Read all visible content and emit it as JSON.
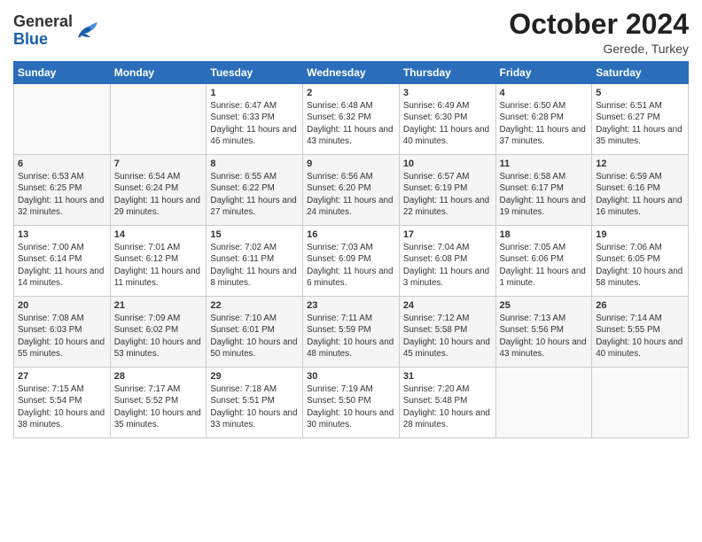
{
  "header": {
    "logo_general": "General",
    "logo_blue": "Blue",
    "title": "October 2024",
    "location": "Gerede, Turkey"
  },
  "weekdays": [
    "Sunday",
    "Monday",
    "Tuesday",
    "Wednesday",
    "Thursday",
    "Friday",
    "Saturday"
  ],
  "weeks": [
    [
      {
        "day": "",
        "info": ""
      },
      {
        "day": "",
        "info": ""
      },
      {
        "day": "1",
        "info": "Sunrise: 6:47 AM\nSunset: 6:33 PM\nDaylight: 11 hours and 46 minutes."
      },
      {
        "day": "2",
        "info": "Sunrise: 6:48 AM\nSunset: 6:32 PM\nDaylight: 11 hours and 43 minutes."
      },
      {
        "day": "3",
        "info": "Sunrise: 6:49 AM\nSunset: 6:30 PM\nDaylight: 11 hours and 40 minutes."
      },
      {
        "day": "4",
        "info": "Sunrise: 6:50 AM\nSunset: 6:28 PM\nDaylight: 11 hours and 37 minutes."
      },
      {
        "day": "5",
        "info": "Sunrise: 6:51 AM\nSunset: 6:27 PM\nDaylight: 11 hours and 35 minutes."
      }
    ],
    [
      {
        "day": "6",
        "info": "Sunrise: 6:53 AM\nSunset: 6:25 PM\nDaylight: 11 hours and 32 minutes."
      },
      {
        "day": "7",
        "info": "Sunrise: 6:54 AM\nSunset: 6:24 PM\nDaylight: 11 hours and 29 minutes."
      },
      {
        "day": "8",
        "info": "Sunrise: 6:55 AM\nSunset: 6:22 PM\nDaylight: 11 hours and 27 minutes."
      },
      {
        "day": "9",
        "info": "Sunrise: 6:56 AM\nSunset: 6:20 PM\nDaylight: 11 hours and 24 minutes."
      },
      {
        "day": "10",
        "info": "Sunrise: 6:57 AM\nSunset: 6:19 PM\nDaylight: 11 hours and 22 minutes."
      },
      {
        "day": "11",
        "info": "Sunrise: 6:58 AM\nSunset: 6:17 PM\nDaylight: 11 hours and 19 minutes."
      },
      {
        "day": "12",
        "info": "Sunrise: 6:59 AM\nSunset: 6:16 PM\nDaylight: 11 hours and 16 minutes."
      }
    ],
    [
      {
        "day": "13",
        "info": "Sunrise: 7:00 AM\nSunset: 6:14 PM\nDaylight: 11 hours and 14 minutes."
      },
      {
        "day": "14",
        "info": "Sunrise: 7:01 AM\nSunset: 6:12 PM\nDaylight: 11 hours and 11 minutes."
      },
      {
        "day": "15",
        "info": "Sunrise: 7:02 AM\nSunset: 6:11 PM\nDaylight: 11 hours and 8 minutes."
      },
      {
        "day": "16",
        "info": "Sunrise: 7:03 AM\nSunset: 6:09 PM\nDaylight: 11 hours and 6 minutes."
      },
      {
        "day": "17",
        "info": "Sunrise: 7:04 AM\nSunset: 6:08 PM\nDaylight: 11 hours and 3 minutes."
      },
      {
        "day": "18",
        "info": "Sunrise: 7:05 AM\nSunset: 6:06 PM\nDaylight: 11 hours and 1 minute."
      },
      {
        "day": "19",
        "info": "Sunrise: 7:06 AM\nSunset: 6:05 PM\nDaylight: 10 hours and 58 minutes."
      }
    ],
    [
      {
        "day": "20",
        "info": "Sunrise: 7:08 AM\nSunset: 6:03 PM\nDaylight: 10 hours and 55 minutes."
      },
      {
        "day": "21",
        "info": "Sunrise: 7:09 AM\nSunset: 6:02 PM\nDaylight: 10 hours and 53 minutes."
      },
      {
        "day": "22",
        "info": "Sunrise: 7:10 AM\nSunset: 6:01 PM\nDaylight: 10 hours and 50 minutes."
      },
      {
        "day": "23",
        "info": "Sunrise: 7:11 AM\nSunset: 5:59 PM\nDaylight: 10 hours and 48 minutes."
      },
      {
        "day": "24",
        "info": "Sunrise: 7:12 AM\nSunset: 5:58 PM\nDaylight: 10 hours and 45 minutes."
      },
      {
        "day": "25",
        "info": "Sunrise: 7:13 AM\nSunset: 5:56 PM\nDaylight: 10 hours and 43 minutes."
      },
      {
        "day": "26",
        "info": "Sunrise: 7:14 AM\nSunset: 5:55 PM\nDaylight: 10 hours and 40 minutes."
      }
    ],
    [
      {
        "day": "27",
        "info": "Sunrise: 7:15 AM\nSunset: 5:54 PM\nDaylight: 10 hours and 38 minutes."
      },
      {
        "day": "28",
        "info": "Sunrise: 7:17 AM\nSunset: 5:52 PM\nDaylight: 10 hours and 35 minutes."
      },
      {
        "day": "29",
        "info": "Sunrise: 7:18 AM\nSunset: 5:51 PM\nDaylight: 10 hours and 33 minutes."
      },
      {
        "day": "30",
        "info": "Sunrise: 7:19 AM\nSunset: 5:50 PM\nDaylight: 10 hours and 30 minutes."
      },
      {
        "day": "31",
        "info": "Sunrise: 7:20 AM\nSunset: 5:48 PM\nDaylight: 10 hours and 28 minutes."
      },
      {
        "day": "",
        "info": ""
      },
      {
        "day": "",
        "info": ""
      }
    ]
  ]
}
